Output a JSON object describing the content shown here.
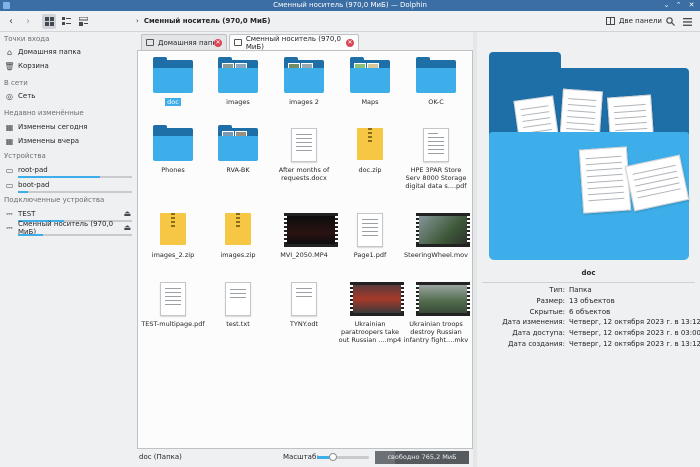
{
  "window": {
    "title": "Сменный носитель (970,0 МиБ) — Dolphin"
  },
  "toolbar": {
    "breadcrumb": "Сменный носитель (970,0 МиБ)",
    "split_label": "Две панели"
  },
  "sidebar": {
    "sections": {
      "places": "Точки входа",
      "network": "В сети",
      "recent": "Недавно изменённые",
      "devices": "Устройства",
      "mounted": "Подключенные устройства"
    },
    "places": [
      {
        "label": "Домашняя папка",
        "icon": "home-icon"
      },
      {
        "label": "Корзина",
        "icon": "trash-icon"
      }
    ],
    "network": [
      {
        "label": "Сеть",
        "icon": "network-icon"
      }
    ],
    "recent": [
      {
        "label": "Изменены сегодня",
        "icon": "calendar-icon"
      },
      {
        "label": "Изменены вчера",
        "icon": "calendar-icon"
      }
    ],
    "devices": [
      {
        "label": "root-pad",
        "icon": "drive-icon",
        "usage": 0.72
      },
      {
        "label": "boot-pad",
        "icon": "drive-icon",
        "usage": 0.09
      }
    ],
    "mounted": [
      {
        "label": "TEST",
        "icon": "usb-icon",
        "usage": 0.4
      },
      {
        "label": "Сменный носитель (970,0 МиБ)",
        "icon": "usb-icon",
        "usage": 0.22
      }
    ]
  },
  "tabs": [
    {
      "label": "Домашняя папка",
      "active": false
    },
    {
      "label": "Сменный носитель (970,0 МиБ)",
      "active": true
    }
  ],
  "files": [
    {
      "name": "doc",
      "kind": "folder"
    },
    {
      "name": "images",
      "kind": "folder"
    },
    {
      "name": "images 2",
      "kind": "folder"
    },
    {
      "name": "Maps",
      "kind": "folder"
    },
    {
      "name": "OK-C",
      "kind": "folder"
    },
    {
      "name": "Phones",
      "kind": "folder"
    },
    {
      "name": "RVA-BK",
      "kind": "folder"
    },
    {
      "name": "After months of requests.docx",
      "kind": "document"
    },
    {
      "name": "doc.zip",
      "kind": "zip"
    },
    {
      "name": "HPE 3PAR Store Serv 8000 Storage digital data s....pdf",
      "kind": "document"
    },
    {
      "name": "images_2.zip",
      "kind": "zip"
    },
    {
      "name": "images.zip",
      "kind": "zip"
    },
    {
      "name": "MVI_2050.MP4",
      "kind": "video"
    },
    {
      "name": "Page1.pdf",
      "kind": "document"
    },
    {
      "name": "SteeringWheel.mov",
      "kind": "video"
    },
    {
      "name": "TEST-multipage.pdf",
      "kind": "document"
    },
    {
      "name": "test.txt",
      "kind": "text"
    },
    {
      "name": "TYNY.odt",
      "kind": "document"
    },
    {
      "name": "Ukrainian paratroopers take out Russian ....mp4",
      "kind": "video"
    },
    {
      "name": "Ukrainian troops destroy Russian infantry fight....mkv",
      "kind": "video"
    }
  ],
  "statusbar": {
    "selection": "doc (Папка)",
    "zoom_label": "Масштаб:",
    "zoom_level": 0.3,
    "free_space": "свободно 765,2 МиБ",
    "used_fraction": 0.21
  },
  "info_panel": {
    "name": "doc",
    "properties": [
      {
        "key": "Тип:",
        "value": "Папка"
      },
      {
        "key": "Размер:",
        "value": "13 объектов"
      },
      {
        "key": "Скрытые:",
        "value": "6 объектов"
      },
      {
        "key": "Дата изменения:",
        "value": "Четверг, 12 октября 2023 г. в 13:12"
      },
      {
        "key": "Дата доступа:",
        "value": "Четверг, 12 октября 2023 г. в 03:00"
      },
      {
        "key": "Дата создания:",
        "value": "Четверг, 12 октября 2023 г. в 13:12"
      }
    ]
  },
  "colors": {
    "accent": "#3daee9",
    "folder_dark": "#1e6fa8",
    "titlebar": "#3b6ea5",
    "close_tab": "#da4453"
  }
}
